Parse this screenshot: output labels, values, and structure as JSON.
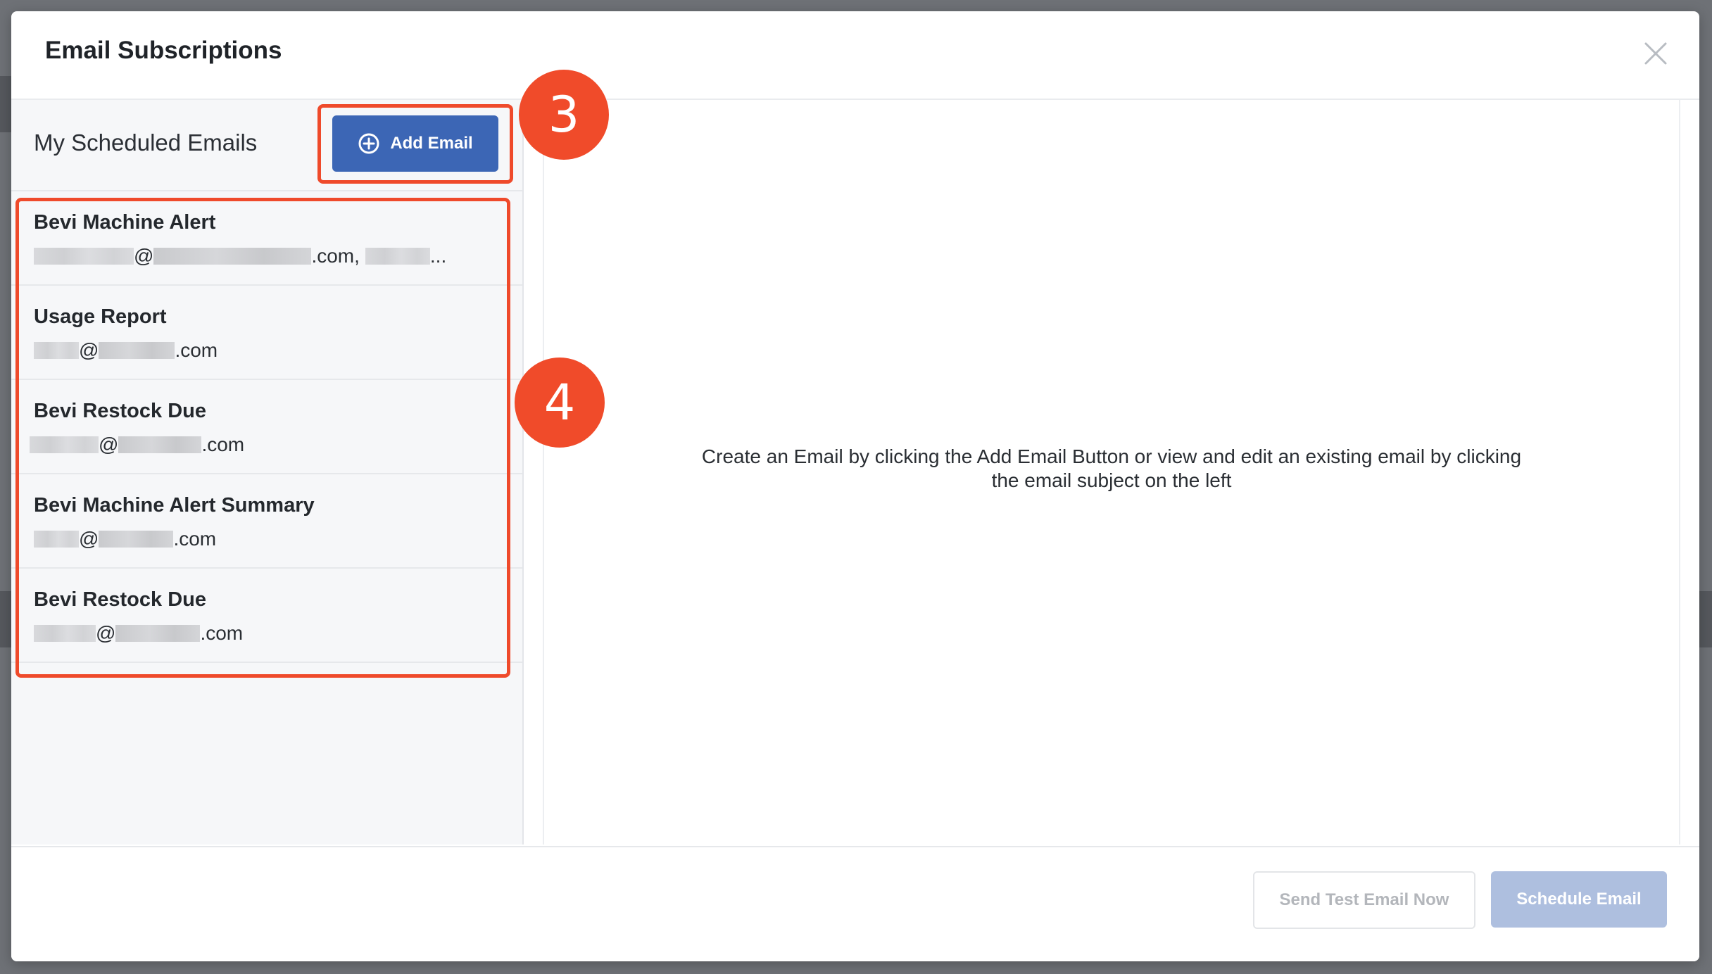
{
  "modal": {
    "title": "Email Subscriptions"
  },
  "left_panel": {
    "title": "My Scheduled Emails",
    "add_button_label": "Add Email",
    "emails": [
      {
        "subject": "Bevi Machine Alert",
        "recipients_suffix": ".com,",
        "truncated": "..."
      },
      {
        "subject": "Usage Report",
        "recipients_suffix": ".com"
      },
      {
        "subject": "Bevi Restock Due",
        "recipients_suffix": ".com"
      },
      {
        "subject": "Bevi Machine Alert Summary",
        "recipients_suffix": ".com"
      },
      {
        "subject": "Bevi Restock Due",
        "recipients_suffix": ".com"
      }
    ]
  },
  "right_panel": {
    "empty_message": "Create an Email by clicking the Add Email Button or view and edit an existing email by clicking the email subject on the left"
  },
  "footer": {
    "send_test_label": "Send Test Email Now",
    "schedule_label": "Schedule Email"
  },
  "annotations": {
    "badge_3": "3",
    "badge_4": "4"
  },
  "colors": {
    "primary_button": "#3c66b5",
    "disabled_primary": "#aebfdf",
    "annotation": "#ef4a2b"
  },
  "icons": {
    "add": "plus-circle-icon",
    "close": "close-icon"
  }
}
